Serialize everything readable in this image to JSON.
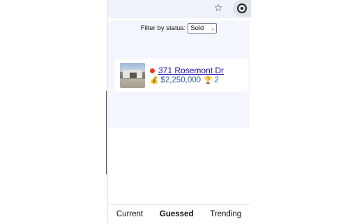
{
  "toolbar": {
    "star_icon": "star-icon",
    "extension_icon": "extension-icon"
  },
  "filter": {
    "label": "Filter by status:",
    "selected": "Sold",
    "caret": "⌄"
  },
  "listing": {
    "status_color": "#e03a1e",
    "address": "371 Rosemont Dr",
    "price": "$2,250,000",
    "guesses": "2",
    "bag_glyph": "💰",
    "trophy_glyph": "🏆"
  },
  "nav": {
    "tabs": [
      {
        "label": "Current"
      },
      {
        "label": "Guessed",
        "active": true
      },
      {
        "label": "Trending"
      }
    ]
  },
  "colors": {
    "accent": "#1a0dab",
    "price": "#2f5fa7",
    "panel_bg": "#f3f6fc"
  }
}
